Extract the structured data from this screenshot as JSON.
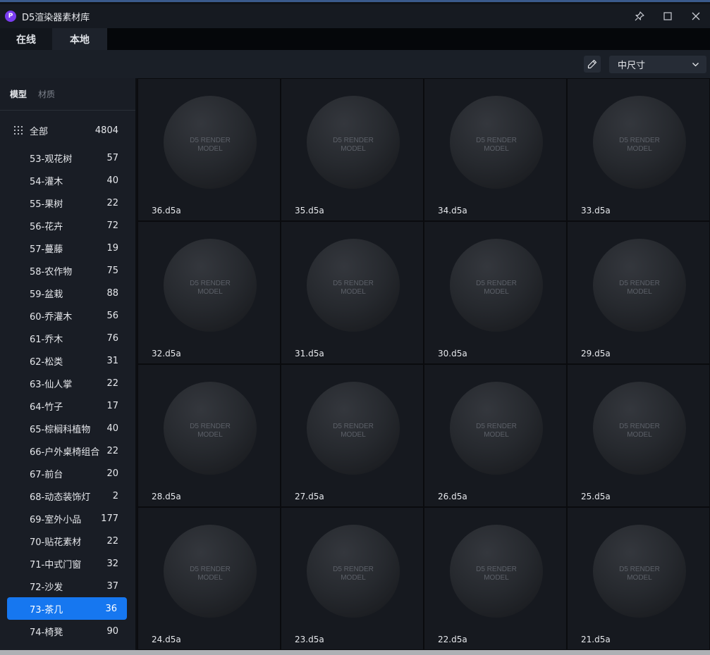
{
  "window": {
    "title": "D5渲染器素材库",
    "logo_letter": "P"
  },
  "tabs": [
    "在线",
    "本地"
  ],
  "toolbar": {
    "size_select": "中尺寸"
  },
  "sidebar": {
    "tabs": [
      "模型",
      "材质"
    ],
    "all": {
      "label": "全部",
      "count": "4804"
    },
    "categories": [
      {
        "label": "53-观花树",
        "count": "57"
      },
      {
        "label": "54-灌木",
        "count": "40"
      },
      {
        "label": "55-果树",
        "count": "22"
      },
      {
        "label": "56-花卉",
        "count": "72"
      },
      {
        "label": "57-蔓藤",
        "count": "19"
      },
      {
        "label": "58-农作物",
        "count": "75"
      },
      {
        "label": "59-盆栽",
        "count": "88"
      },
      {
        "label": "60-乔灌木",
        "count": "56"
      },
      {
        "label": "61-乔木",
        "count": "76"
      },
      {
        "label": "62-松类",
        "count": "31"
      },
      {
        "label": "63-仙人掌",
        "count": "22"
      },
      {
        "label": "64-竹子",
        "count": "17"
      },
      {
        "label": "65-棕榈科植物",
        "count": "40"
      },
      {
        "label": "66-户外桌椅组合",
        "count": "22"
      },
      {
        "label": "67-前台",
        "count": "20"
      },
      {
        "label": "68-动态装饰灯",
        "count": "2"
      },
      {
        "label": "69-室外小品",
        "count": "177"
      },
      {
        "label": "70-贴花素材",
        "count": "22"
      },
      {
        "label": "71-中式门窗",
        "count": "32"
      },
      {
        "label": "72-沙发",
        "count": "37"
      },
      {
        "label": "73-茶几",
        "count": "36"
      },
      {
        "label": "74-椅凳",
        "count": "90"
      }
    ],
    "selected_index": 20
  },
  "thumbnail_text": {
    "line1": "D5 RENDER",
    "line2": "MODEL"
  },
  "models": [
    "36.d5a",
    "35.d5a",
    "34.d5a",
    "33.d5a",
    "32.d5a",
    "31.d5a",
    "30.d5a",
    "29.d5a",
    "28.d5a",
    "27.d5a",
    "26.d5a",
    "25.d5a",
    "24.d5a",
    "23.d5a",
    "22.d5a",
    "21.d5a"
  ],
  "colors": {
    "accent": "#1677f0",
    "logo": "#7a3cf0"
  }
}
